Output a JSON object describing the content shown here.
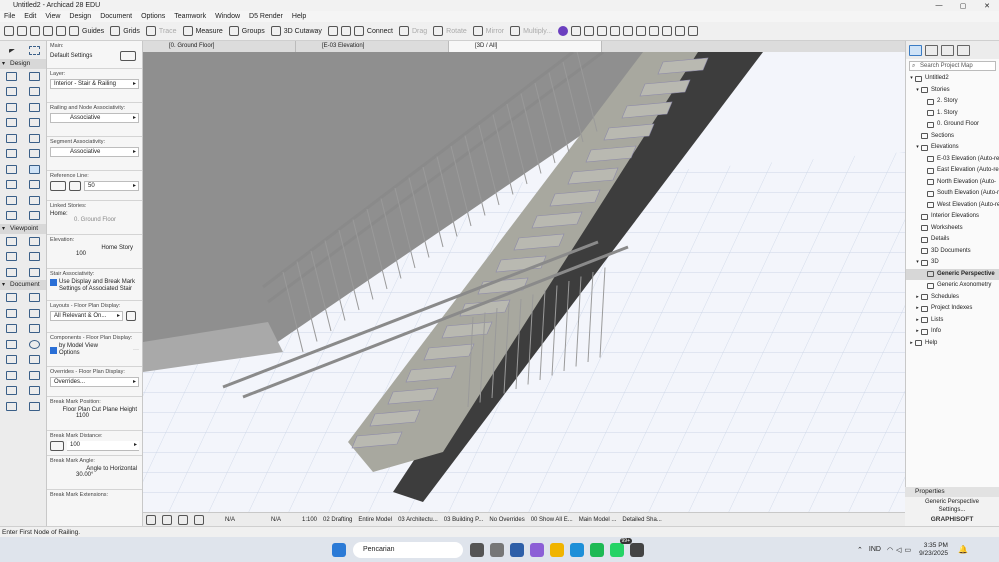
{
  "titlebar": {
    "title": "Untitled2 - Archicad 28 EDU",
    "min": "—",
    "max": "▢",
    "close": "✕"
  },
  "menu": [
    "File",
    "Edit",
    "View",
    "Design",
    "Document",
    "Options",
    "Teamwork",
    "Window",
    "D5 Render",
    "Help"
  ],
  "toolbar": {
    "guides": "Guides",
    "grids": "Grids",
    "trace": "Trace",
    "measure": "Measure",
    "groups": "Groups",
    "cutaway": "3D Cutaway",
    "connect": "Connect",
    "drag": "Drag",
    "rotate": "Rotate",
    "mirror": "Mirror",
    "multiply": "Multiply..."
  },
  "tabs": [
    {
      "label": "[0. Ground Floor]"
    },
    {
      "label": "[E-03 Elevation]"
    },
    {
      "label": "[3D / All]"
    }
  ],
  "toolbox": {
    "design": "Design",
    "viewpoint": "Viewpoint",
    "document": "Document"
  },
  "info": {
    "main": "Main:",
    "default_settings": "Default Settings",
    "layer_label": "Layer:",
    "layer_value": "Interior - Stair & Railing",
    "railing_assoc_label": "Railing and Node Associativity:",
    "railing_assoc_value": "Associative",
    "segment_assoc_label": "Segment Associativity:",
    "segment_assoc_value": "Associative",
    "ref_line_label": "Reference Line:",
    "ref_line_value": "50",
    "linked_label": "Linked Stories:",
    "home_label": "Home:",
    "home_value": "0. Ground Floor",
    "elevation_label": "Elevation:",
    "elevation_story": "Home Story",
    "elevation_value": "100",
    "stair_assoc_label": "Stair Associativity:",
    "stair_assoc_value": "Use Display and Break Mark Settings of Associated Stair",
    "layouts_label": "Layouts - Floor Plan Display:",
    "layouts_value": "All Relevant & On...",
    "components_label": "Components - Floor Plan Display:",
    "components_value": "by Model View Options",
    "overrides_label": "Overrides - Floor Plan Display:",
    "overrides_value": "Overrides...",
    "break_pos_label": "Break Mark Position:",
    "break_pos_value": "Floor Plan Cut Plane Height",
    "break_pos_num": "1100",
    "break_dist_label": "Break Mark Distance:",
    "break_dist_value": "100",
    "break_angle_label": "Break Mark Angle:",
    "break_angle_value": "Angle to Horizontal",
    "break_angle_num": "30.00°",
    "break_ext_label": "Break Mark Extensions:"
  },
  "viewbar": [
    "N/A",
    "N/A",
    "1:100",
    "02 Drafting",
    "Entire Model",
    "03 Architectu...",
    "03 Building P...",
    "No Overrides",
    "00 Show All E...",
    "Main Model ...",
    "Detailed Sha..."
  ],
  "navigator": {
    "search": "Search Project Map",
    "items": [
      {
        "label": "Untitled2",
        "depth": 0,
        "tw": "▾"
      },
      {
        "label": "Stories",
        "depth": 1,
        "tw": "▾"
      },
      {
        "label": "2. Story",
        "depth": 2,
        "tw": ""
      },
      {
        "label": "1. Story",
        "depth": 2,
        "tw": ""
      },
      {
        "label": "0. Ground Floor",
        "depth": 2,
        "tw": ""
      },
      {
        "label": "Sections",
        "depth": 1,
        "tw": ""
      },
      {
        "label": "Elevations",
        "depth": 1,
        "tw": "▾"
      },
      {
        "label": "E-03 Elevation (Auto-re",
        "depth": 2,
        "tw": ""
      },
      {
        "label": "East Elevation (Auto-re",
        "depth": 2,
        "tw": ""
      },
      {
        "label": "North Elevation (Auto-",
        "depth": 2,
        "tw": ""
      },
      {
        "label": "South Elevation (Auto-r",
        "depth": 2,
        "tw": ""
      },
      {
        "label": "West Elevation (Auto-re",
        "depth": 2,
        "tw": ""
      },
      {
        "label": "Interior Elevations",
        "depth": 1,
        "tw": ""
      },
      {
        "label": "Worksheets",
        "depth": 1,
        "tw": ""
      },
      {
        "label": "Details",
        "depth": 1,
        "tw": ""
      },
      {
        "label": "3D Documents",
        "depth": 1,
        "tw": ""
      },
      {
        "label": "3D",
        "depth": 1,
        "tw": "▾"
      },
      {
        "label": "Generic Perspective",
        "depth": 2,
        "tw": "",
        "selected": true
      },
      {
        "label": "Generic Axonometry",
        "depth": 2,
        "tw": ""
      },
      {
        "label": "Schedules",
        "depth": 1,
        "tw": "▸"
      },
      {
        "label": "Project Indexes",
        "depth": 1,
        "tw": "▸"
      },
      {
        "label": "Lists",
        "depth": 1,
        "tw": "▸"
      },
      {
        "label": "Info",
        "depth": 1,
        "tw": "▸"
      },
      {
        "label": "Help",
        "depth": 0,
        "tw": "▸"
      }
    ]
  },
  "properties": {
    "header": "Properties",
    "value": "Generic Perspective",
    "settings": "Settings...",
    "brand": "GRAPHISOFT"
  },
  "status": "Enter First Node of Railing.",
  "taskbar": {
    "search": "Pencarian",
    "lang": "IND",
    "time": "3:35 PM",
    "date": "9/23/2025",
    "badge": "99+"
  }
}
